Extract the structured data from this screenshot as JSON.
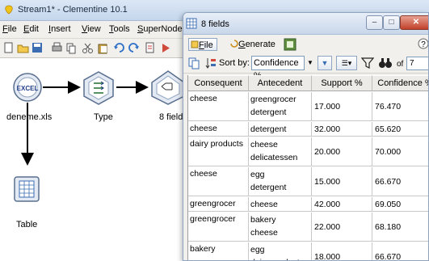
{
  "main_window": {
    "title": "Stream1* - Clementine 10.1",
    "menu": [
      {
        "label": "File",
        "key": "F",
        "rest": "ile"
      },
      {
        "label": "Edit",
        "key": "E",
        "rest": "dit"
      },
      {
        "label": "Insert",
        "key": "I",
        "rest": "nsert"
      },
      {
        "label": "View",
        "key": "V",
        "rest": "iew"
      },
      {
        "label": "Tools",
        "key": "T",
        "rest": "ools"
      },
      {
        "label": "SuperNode",
        "key": "S",
        "rest": "uperNode"
      }
    ],
    "nodes": {
      "source": {
        "label": "deneme.xls",
        "icon_text": "EXCEL"
      },
      "type": {
        "label": "Type"
      },
      "output": {
        "label": "8 fields"
      },
      "table": {
        "label": "Table"
      }
    }
  },
  "output_window": {
    "title": "8 fields",
    "menu": {
      "file": {
        "key": "F",
        "rest": "ile"
      },
      "generate": {
        "key": "G",
        "rest": "enerate"
      }
    },
    "toolbar": {
      "sort_label": "Sort by:",
      "sort_value": "Confidence %",
      "of_label": "of",
      "of_value": "7"
    },
    "table": {
      "columns": [
        "Consequent",
        "Antecedent",
        "Support %",
        "Confidence %"
      ],
      "rows": [
        {
          "consequent": "cheese",
          "antecedent": [
            "greengrocer",
            "detergent"
          ],
          "support": "17.000",
          "confidence": "76.470"
        },
        {
          "consequent": "cheese",
          "antecedent": [
            "detergent"
          ],
          "support": "32.000",
          "confidence": "65.620"
        },
        {
          "consequent": "dairy products",
          "antecedent": [
            "cheese",
            "delicatessen"
          ],
          "support": "20.000",
          "confidence": "70.000"
        },
        {
          "consequent": "cheese",
          "antecedent": [
            "egg",
            "detergent"
          ],
          "support": "15.000",
          "confidence": "66.670"
        },
        {
          "consequent": "greengrocer",
          "antecedent": [
            "cheese"
          ],
          "support": "42.000",
          "confidence": "69.050"
        },
        {
          "consequent": "greengrocer",
          "antecedent": [
            "bakery",
            "cheese"
          ],
          "support": "22.000",
          "confidence": "68.180"
        },
        {
          "consequent": "bakery",
          "antecedent": [
            "egg",
            "dairy products"
          ],
          "support": "18.000",
          "confidence": "66.670"
        }
      ]
    }
  }
}
